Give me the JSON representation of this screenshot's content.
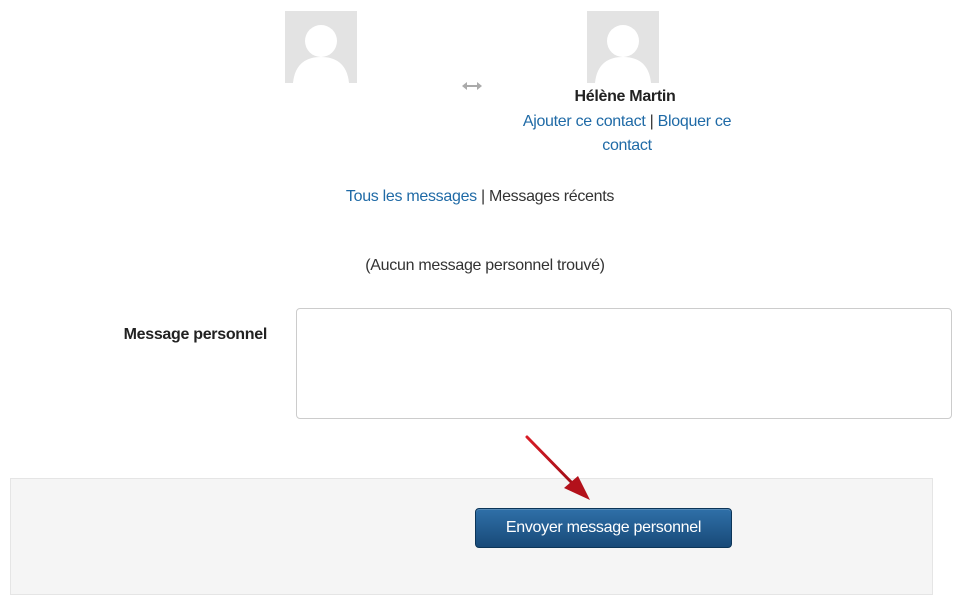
{
  "contact": {
    "name": "Hélène Martin",
    "add_label": "Ajouter ce contact",
    "separator": "|",
    "block_label": "Bloquer ce contact"
  },
  "icons": {
    "swap": "left-right-arrow-icon",
    "avatar": "default-user-avatar-icon"
  },
  "filters": {
    "all_messages_label": "Tous les messages",
    "separator": "|",
    "recent_messages_label": "Messages récents"
  },
  "messages": {
    "empty_text": "(Aucun message personnel trouvé)"
  },
  "form": {
    "field_label": "Message personnel",
    "textarea_value": "",
    "submit_label": "Envoyer message personnel"
  },
  "colors": {
    "link": "#1f6aa6",
    "button": "#1f5688",
    "annotation_arrow": "#c0121e",
    "avatar_bg": "#e3e3e3"
  }
}
